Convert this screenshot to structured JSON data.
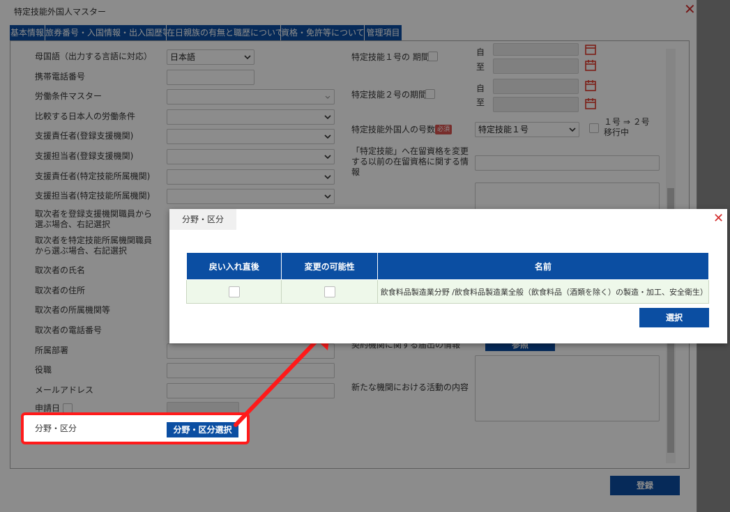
{
  "window": {
    "title": "特定技能外国人マスター",
    "close_glyph": "✕"
  },
  "tabs": [
    "基本情報",
    "旅券番号・入国情報・出入国歴等",
    "在日親族の有無と職歴について",
    "資格・免許等について",
    "管理項目"
  ],
  "left_fields": [
    {
      "label": "母国語（出力する言語に対応）",
      "type": "select",
      "value": "日本語"
    },
    {
      "label": "携帯電話番号",
      "type": "text",
      "value": ""
    },
    {
      "label": "労働条件マスター",
      "type": "select",
      "value": ""
    },
    {
      "label": "比較する日本人の労働条件",
      "type": "select",
      "value": ""
    },
    {
      "label": "支援責任者(登録支援機関)",
      "type": "select",
      "value": ""
    },
    {
      "label": "支援担当者(登録支援機関)",
      "type": "select",
      "value": ""
    },
    {
      "label": "支援責任者(特定技能所属機関)",
      "type": "select",
      "value": ""
    },
    {
      "label": "支援担当者(特定技能所属機関)",
      "type": "select",
      "value": ""
    }
  ],
  "left_labels_mid": [
    "取次者を登録支援機関職員から\n選ぶ場合、右記選択",
    "取次者を特定技能所属機関職員\nから選ぶ場合、右記選択",
    "取次者の氏名",
    "取次者の住所",
    "取次者の所属機関等",
    "取次者の電話番号",
    "所属部署",
    "役職",
    "メールアドレス",
    "申請日"
  ],
  "field_category": {
    "label": "分野・区分",
    "button": "分野・区分選択"
  },
  "right": {
    "period1_label": "特定技能１号の 期間",
    "period2_label": "特定技能２号の期間",
    "from": "自",
    "to": "至",
    "number_label": "特定技能外国人の号数",
    "required": "必須",
    "number_value": "特定技能１号",
    "transition_label": "１号 ⇒ ２号\n移行中",
    "prior_status_label": "「特定技能」へ在留資格を変更\nする以前の在留資格に関する情\n報",
    "contract_label": "契約機関に関する届出の情報",
    "contract_button": "参照",
    "new_activity_label": "新たな機関における活動の内容"
  },
  "register_button": "登録",
  "modal": {
    "title": "分野・区分",
    "close_glyph": "✕",
    "headers": [
      "戻い入れ直後",
      "変更の可能性",
      "名前"
    ],
    "rows": [
      {
        "name": "飲食料品製造業分野 /飲食料品製造業全般（飲食料品（酒類を除く）の製造・加工、安全衛生）"
      }
    ],
    "select_button": "選択"
  },
  "colors": {
    "primary": "#0b4ea2",
    "highlight": "#ff1a1a",
    "close": "#d32b2b"
  }
}
